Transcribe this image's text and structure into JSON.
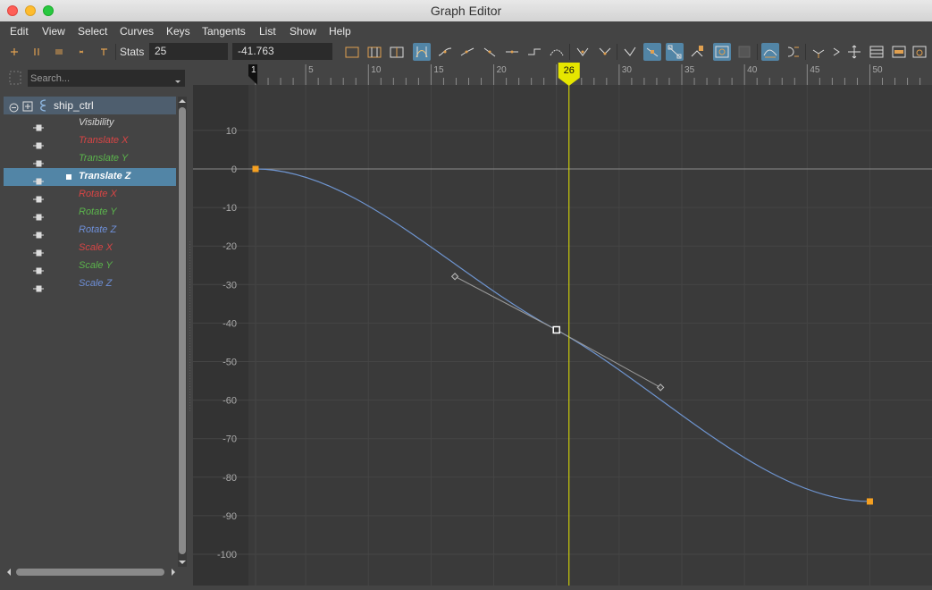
{
  "window": {
    "title": "Graph Editor"
  },
  "menu": [
    "Edit",
    "View",
    "Select",
    "Curves",
    "Keys",
    "Tangents",
    "List",
    "Show",
    "Help"
  ],
  "toolbar": {
    "stats_label": "Stats",
    "stats_frame": "25",
    "stats_value": "-41.763"
  },
  "outliner": {
    "search_placeholder": "Search...",
    "node": "ship_ctrl",
    "attributes": [
      {
        "label": "Visibility",
        "color": "#d8d8d8",
        "selected": false
      },
      {
        "label": "Translate X",
        "color": "#d84545",
        "selected": false
      },
      {
        "label": "Translate Y",
        "color": "#5bb54c",
        "selected": false
      },
      {
        "label": "Translate Z",
        "color": "#ffffff",
        "selected": true
      },
      {
        "label": "Rotate X",
        "color": "#d84545",
        "selected": false
      },
      {
        "label": "Rotate Y",
        "color": "#5bb54c",
        "selected": false
      },
      {
        "label": "Rotate Z",
        "color": "#6e8fd8",
        "selected": false
      },
      {
        "label": "Scale X",
        "color": "#d84545",
        "selected": false
      },
      {
        "label": "Scale Y",
        "color": "#5bb54c",
        "selected": false
      },
      {
        "label": "Scale Z",
        "color": "#6e8fd8",
        "selected": false
      }
    ]
  },
  "graph": {
    "current_frame": "26",
    "start_frame_label": "1",
    "frame_labels": [
      "5",
      "10",
      "15",
      "20",
      "25",
      "30",
      "35",
      "40",
      "45",
      "50"
    ],
    "value_labels": [
      "10",
      "0",
      "-10",
      "-20",
      "-30",
      "-40",
      "-50",
      "-60",
      "-70",
      "-80",
      "-90",
      "-100"
    ],
    "colors": {
      "curve": "#6e94cf",
      "time_indicator": "#e6e600",
      "key": "#f5a021",
      "grid_bg": "#3a3a3a"
    },
    "curve_keys": [
      {
        "frame": 1,
        "value": 0
      },
      {
        "frame": 25,
        "value": -41.763
      },
      {
        "frame": 50,
        "value": -86.3
      }
    ],
    "selected_key_tangents": {
      "in": {
        "frame": 16.9,
        "value": -27.9
      },
      "out": {
        "frame": 33.3,
        "value": -56.7
      }
    }
  }
}
